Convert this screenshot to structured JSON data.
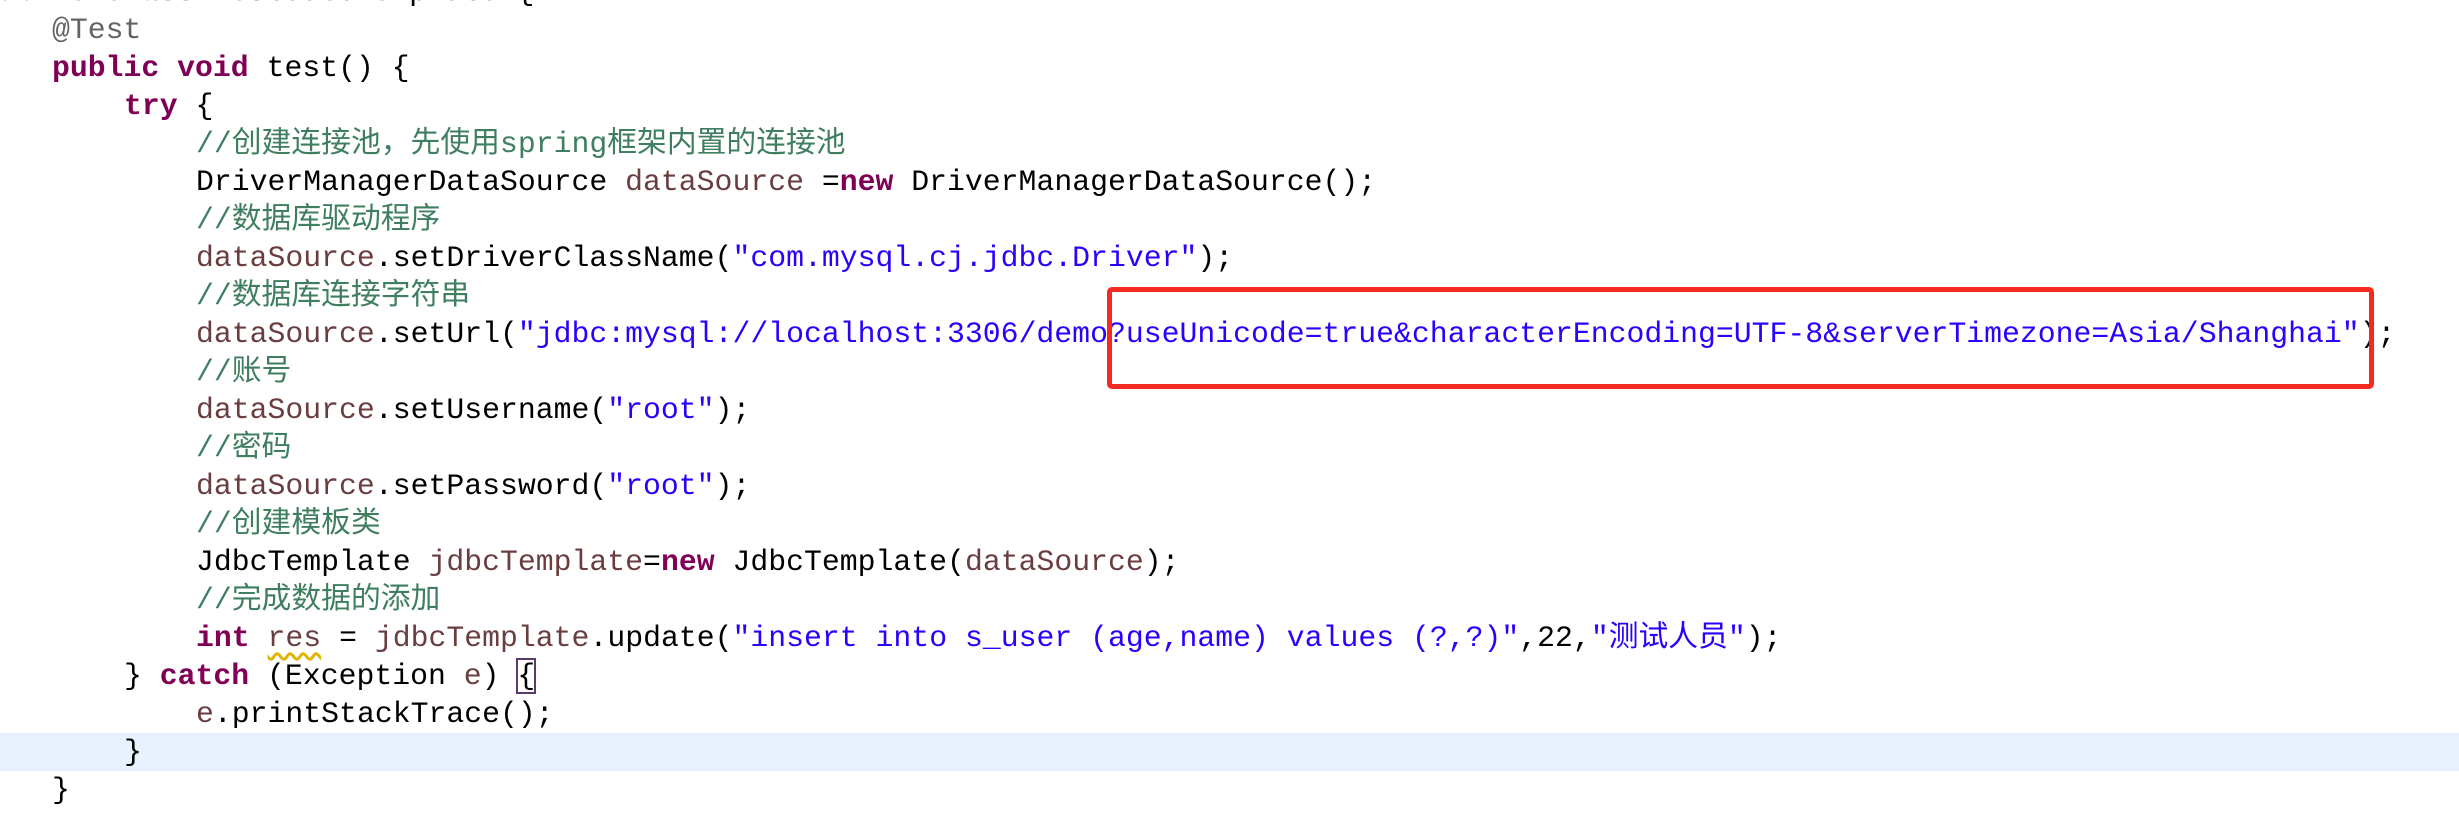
{
  "editor": {
    "current_line": 20,
    "lines": [
      {
        "indent": 0,
        "tokens": [
          [
            "kw",
            "public class "
          ],
          [
            "plain",
            "TestJdbcTemplate {"
          ]
        ]
      },
      {
        "indent": 1,
        "tokens": [
          [
            "an",
            "@Test"
          ]
        ]
      },
      {
        "indent": 1,
        "tokens": [
          [
            "kw",
            "public void "
          ],
          [
            "plain",
            "test() {"
          ]
        ]
      },
      {
        "indent": 2,
        "tokens": [
          [
            "kw",
            "try"
          ],
          [
            "plain",
            " {"
          ]
        ]
      },
      {
        "indent": 3,
        "tokens": [
          [
            "cm",
            "//创建连接池，先使用spring框架内置的连接池"
          ]
        ]
      },
      {
        "indent": 3,
        "tokens": [
          [
            "plain",
            "DriverManagerDataSource "
          ],
          [
            "var",
            "dataSource"
          ],
          [
            "plain",
            " ="
          ],
          [
            "kw",
            "new"
          ],
          [
            "plain",
            " DriverManagerDataSource();"
          ]
        ]
      },
      {
        "indent": 3,
        "tokens": [
          [
            "cm",
            "//数据库驱动程序"
          ]
        ]
      },
      {
        "indent": 3,
        "tokens": [
          [
            "var",
            "dataSource"
          ],
          [
            "plain",
            ".setDriverClassName("
          ],
          [
            "str",
            "\"com.mysql.cj.jdbc.Driver\""
          ],
          [
            "plain",
            ");"
          ]
        ]
      },
      {
        "indent": 3,
        "tokens": [
          [
            "cm",
            "//数据库连接字符串"
          ]
        ]
      },
      {
        "indent": 3,
        "tokens": [
          [
            "var",
            "dataSource"
          ],
          [
            "plain",
            ".setUrl("
          ],
          [
            "str",
            "\"jdbc:mysql://localhost:3306/demo?useUnicode=true&characterEncoding=UTF-8&serverTimezone=Asia/Shanghai\""
          ],
          [
            "plain",
            ");"
          ]
        ]
      },
      {
        "indent": 3,
        "tokens": [
          [
            "cm",
            "//账号"
          ]
        ]
      },
      {
        "indent": 3,
        "tokens": [
          [
            "var",
            "dataSource"
          ],
          [
            "plain",
            ".setUsername("
          ],
          [
            "str",
            "\"root\""
          ],
          [
            "plain",
            ");"
          ]
        ]
      },
      {
        "indent": 3,
        "tokens": [
          [
            "cm",
            "//密码"
          ]
        ]
      },
      {
        "indent": 3,
        "tokens": [
          [
            "var",
            "dataSource"
          ],
          [
            "plain",
            ".setPassword("
          ],
          [
            "str",
            "\"root\""
          ],
          [
            "plain",
            ");"
          ]
        ]
      },
      {
        "indent": 3,
        "tokens": [
          [
            "cm",
            "//创建模板类"
          ]
        ]
      },
      {
        "indent": 3,
        "tokens": [
          [
            "plain",
            "JdbcTemplate "
          ],
          [
            "var",
            "jdbcTemplate"
          ],
          [
            "plain",
            "="
          ],
          [
            "kw",
            "new"
          ],
          [
            "plain",
            " JdbcTemplate("
          ],
          [
            "var",
            "dataSource"
          ],
          [
            "plain",
            ");"
          ]
        ]
      },
      {
        "indent": 3,
        "tokens": [
          [
            "cm",
            "//完成数据的添加"
          ]
        ]
      },
      {
        "indent": 3,
        "tokens": [
          [
            "kw",
            "int"
          ],
          [
            "plain",
            " "
          ],
          [
            "var warn",
            "res"
          ],
          [
            "plain",
            " = "
          ],
          [
            "var",
            "jdbcTemplate"
          ],
          [
            "plain",
            ".update("
          ],
          [
            "str",
            "\"insert into s_user (age,name) values (?,?)\""
          ],
          [
            "plain",
            ",22,"
          ],
          [
            "str",
            "\"测试人员\""
          ],
          [
            "plain",
            ");"
          ]
        ]
      },
      {
        "indent": 2,
        "tokens": [
          [
            "plain",
            "} "
          ],
          [
            "kw",
            "catch"
          ],
          [
            "plain",
            " (Exception "
          ],
          [
            "var",
            "e"
          ],
          [
            "plain",
            ") "
          ],
          [
            "match",
            "{"
          ]
        ]
      },
      {
        "indent": 3,
        "tokens": [
          [
            "var",
            "e"
          ],
          [
            "plain",
            ".printStackTrace();"
          ]
        ]
      },
      {
        "indent": 2,
        "tokens": [
          [
            "plain",
            "}"
          ]
        ]
      },
      {
        "indent": 1,
        "tokens": [
          [
            "plain",
            "}"
          ]
        ]
      }
    ]
  },
  "annotation": {
    "color": "#f52a1f"
  }
}
